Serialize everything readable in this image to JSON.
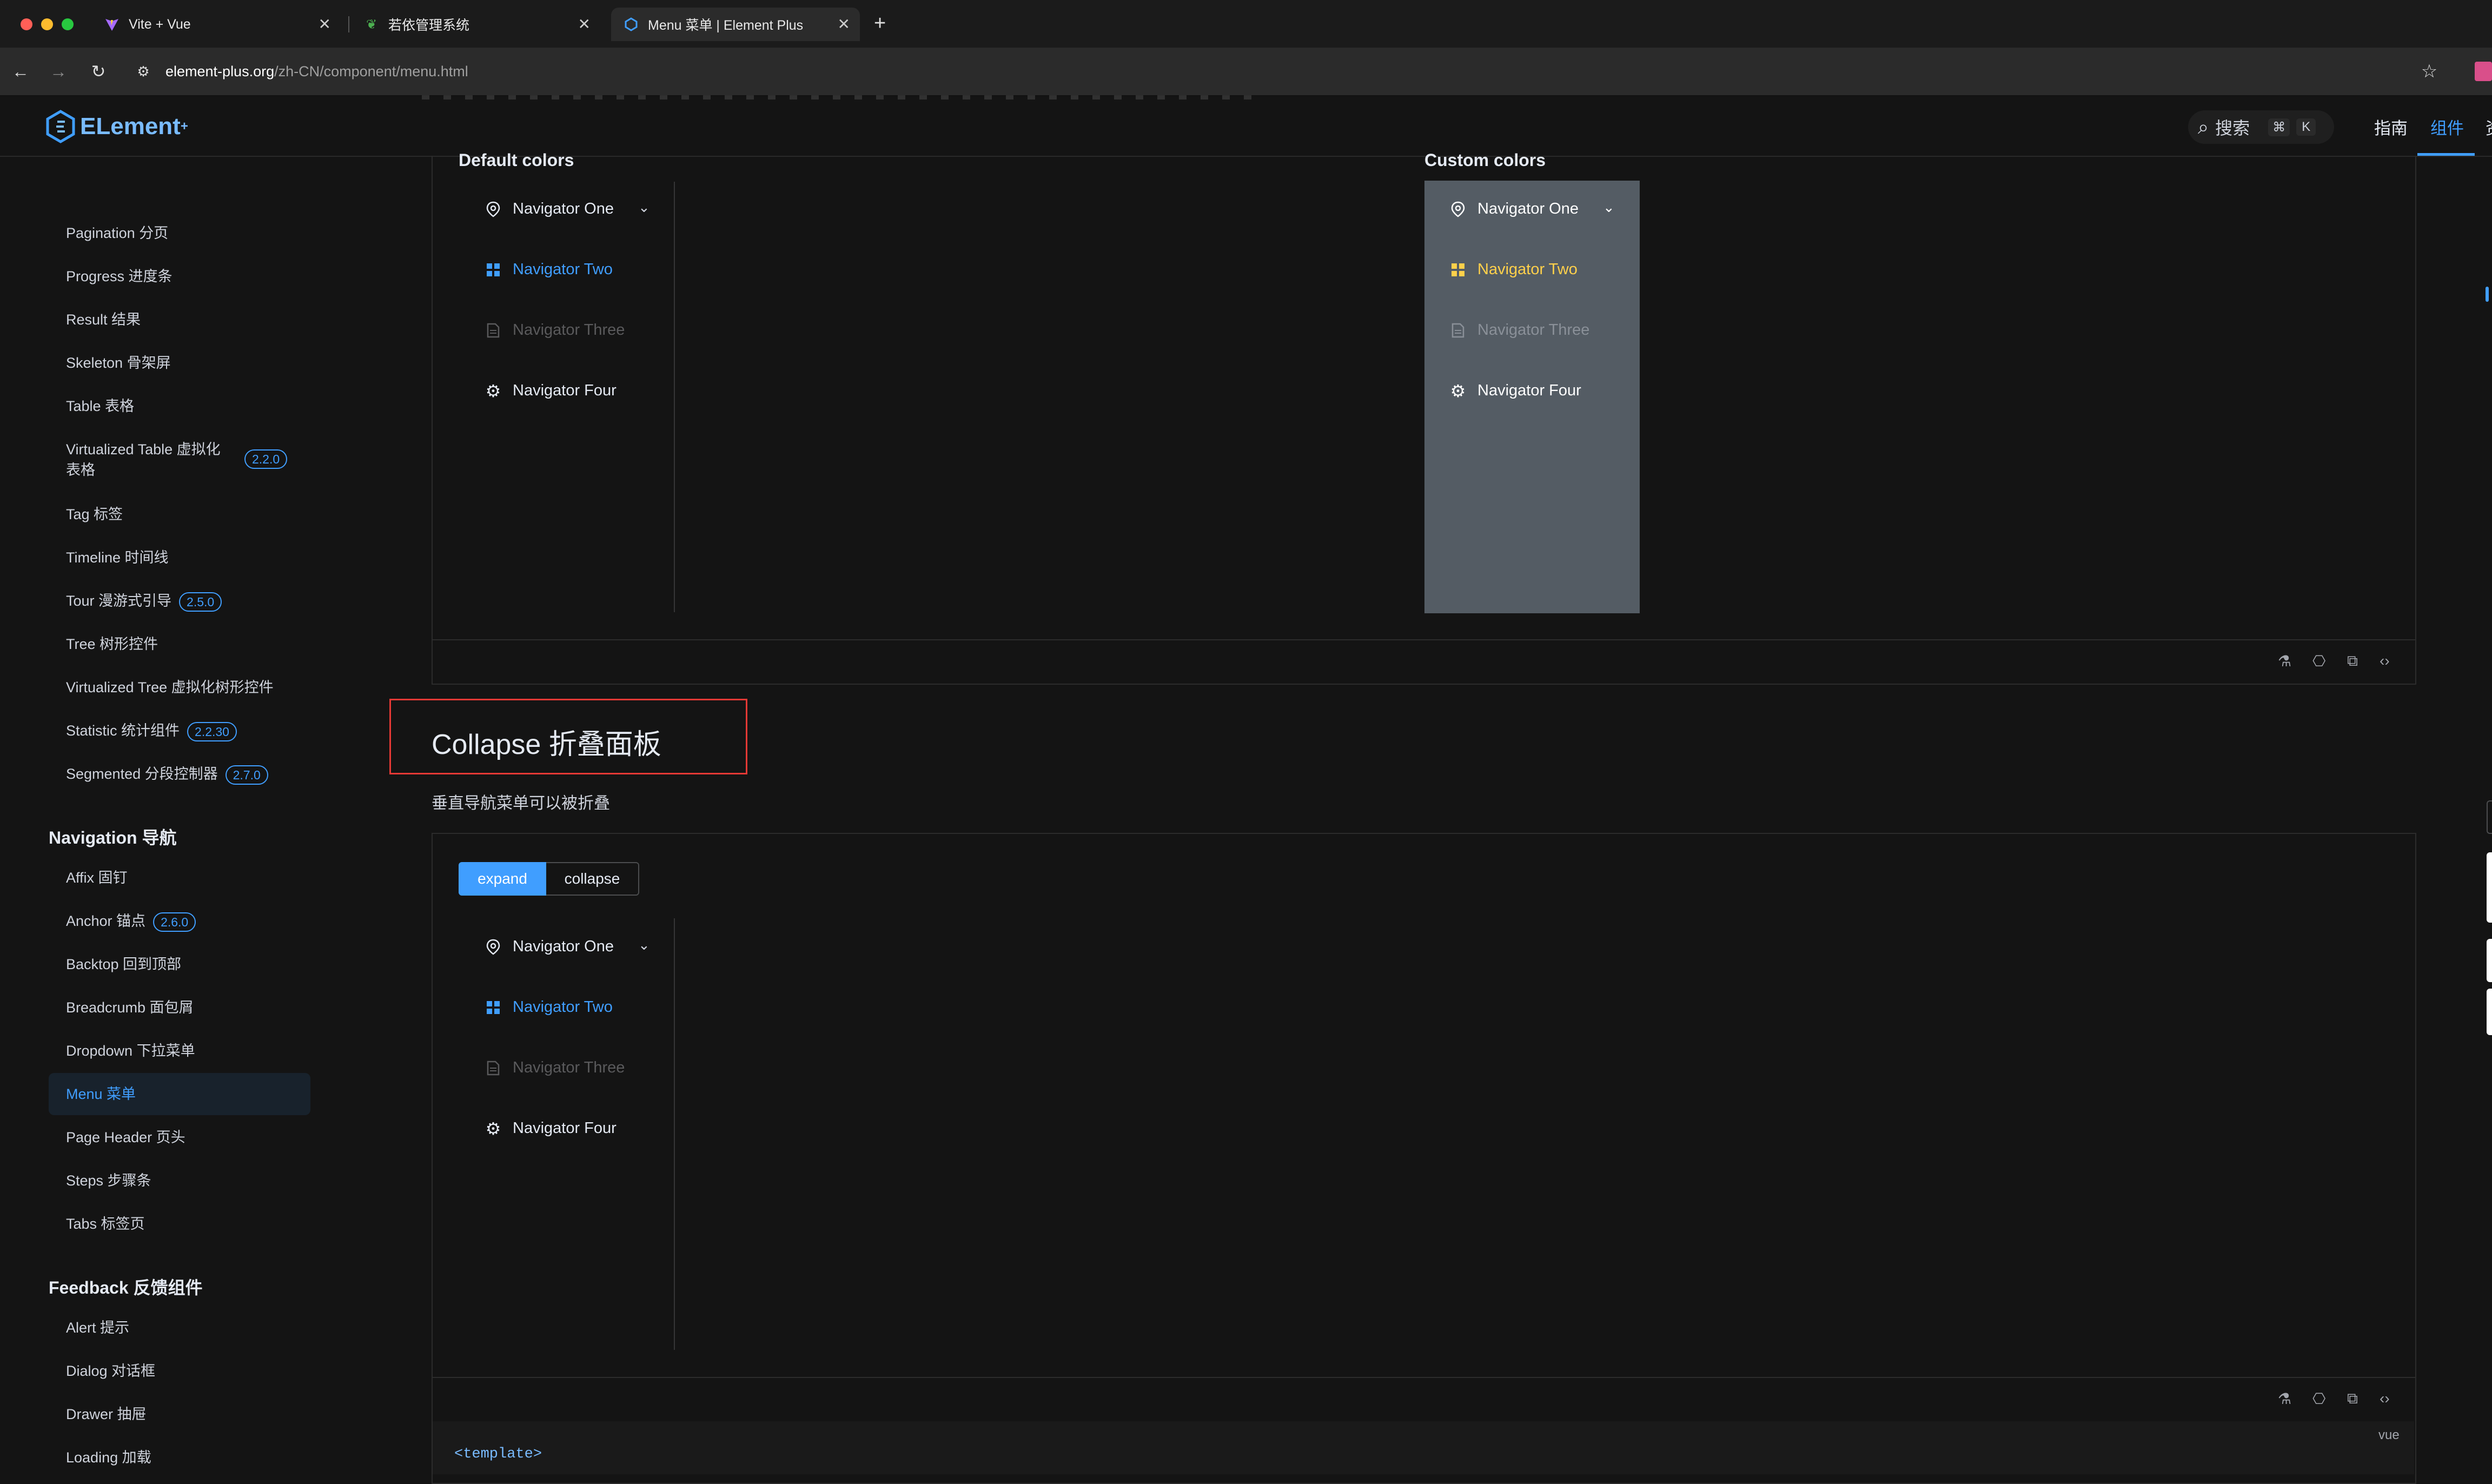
{
  "browser": {
    "tabs": [
      {
        "title": "Vite + Vue",
        "icon": "vite-icon"
      },
      {
        "title": "若依管理系统",
        "icon": "ruoyi-icon"
      },
      {
        "title": "Menu 菜单 | Element Plus",
        "icon": "element-icon"
      }
    ],
    "url_domain": "element-plus.org",
    "url_path": "/zh-CN/component/menu.html"
  },
  "header": {
    "logo_text": "ELement",
    "logo_sup": "+",
    "search_placeholder": "搜索",
    "search_shortcut_mod": "⌘",
    "search_shortcut_key": "K",
    "nav": [
      "指南",
      "组件",
      "资"
    ]
  },
  "sidebar": {
    "data_items": [
      {
        "label": "Pagination 分页"
      },
      {
        "label": "Progress 进度条"
      },
      {
        "label": "Result 结果"
      },
      {
        "label": "Skeleton 骨架屏"
      },
      {
        "label": "Table 表格"
      },
      {
        "label": "Virtualized Table 虚拟化",
        "label2": "表格",
        "badge": "2.2.0"
      },
      {
        "label": "Tag 标签"
      },
      {
        "label": "Timeline 时间线"
      },
      {
        "label": "Tour 漫游式引导",
        "badge": "2.5.0"
      },
      {
        "label": "Tree 树形控件"
      },
      {
        "label": "Virtualized Tree 虚拟化树形控件"
      },
      {
        "label": "Statistic 统计组件",
        "badge": "2.2.30"
      },
      {
        "label": "Segmented 分段控制器",
        "badge": "2.7.0"
      }
    ],
    "nav_group_title": "Navigation 导航",
    "nav_items": [
      {
        "label": "Affix 固钉"
      },
      {
        "label": "Anchor 锚点",
        "badge": "2.6.0"
      },
      {
        "label": "Backtop 回到顶部"
      },
      {
        "label": "Breadcrumb 面包屑"
      },
      {
        "label": "Dropdown 下拉菜单"
      },
      {
        "label": "Menu 菜单"
      },
      {
        "label": "Page Header 页头"
      },
      {
        "label": "Steps 步骤条"
      },
      {
        "label": "Tabs 标签页"
      }
    ],
    "feedback_group_title": "Feedback 反馈组件",
    "feedback_items": [
      {
        "label": "Alert 提示"
      },
      {
        "label": "Dialog 对话框"
      },
      {
        "label": "Drawer 抽屉"
      },
      {
        "label": "Loading 加载"
      }
    ]
  },
  "demo1": {
    "default_title": "Default colors",
    "custom_title": "Custom colors",
    "items": [
      "Navigator One",
      "Navigator Two",
      "Navigator Three",
      "Navigator Four"
    ]
  },
  "section": {
    "title": "Collapse 折叠面板",
    "desc": "垂直导航菜单可以被折叠"
  },
  "demo2": {
    "btn_expand": "expand",
    "btn_collapse": "collapse",
    "items": [
      "Navigator One",
      "Navigator Two",
      "Navigator Three",
      "Navigator Four"
    ],
    "code_lang": "vue",
    "code_line": "<template>"
  },
  "colors": {
    "accent": "#409eff",
    "custom_bg": "#545c64",
    "custom_active": "#ffd04b",
    "highlight_box": "#e53935"
  }
}
